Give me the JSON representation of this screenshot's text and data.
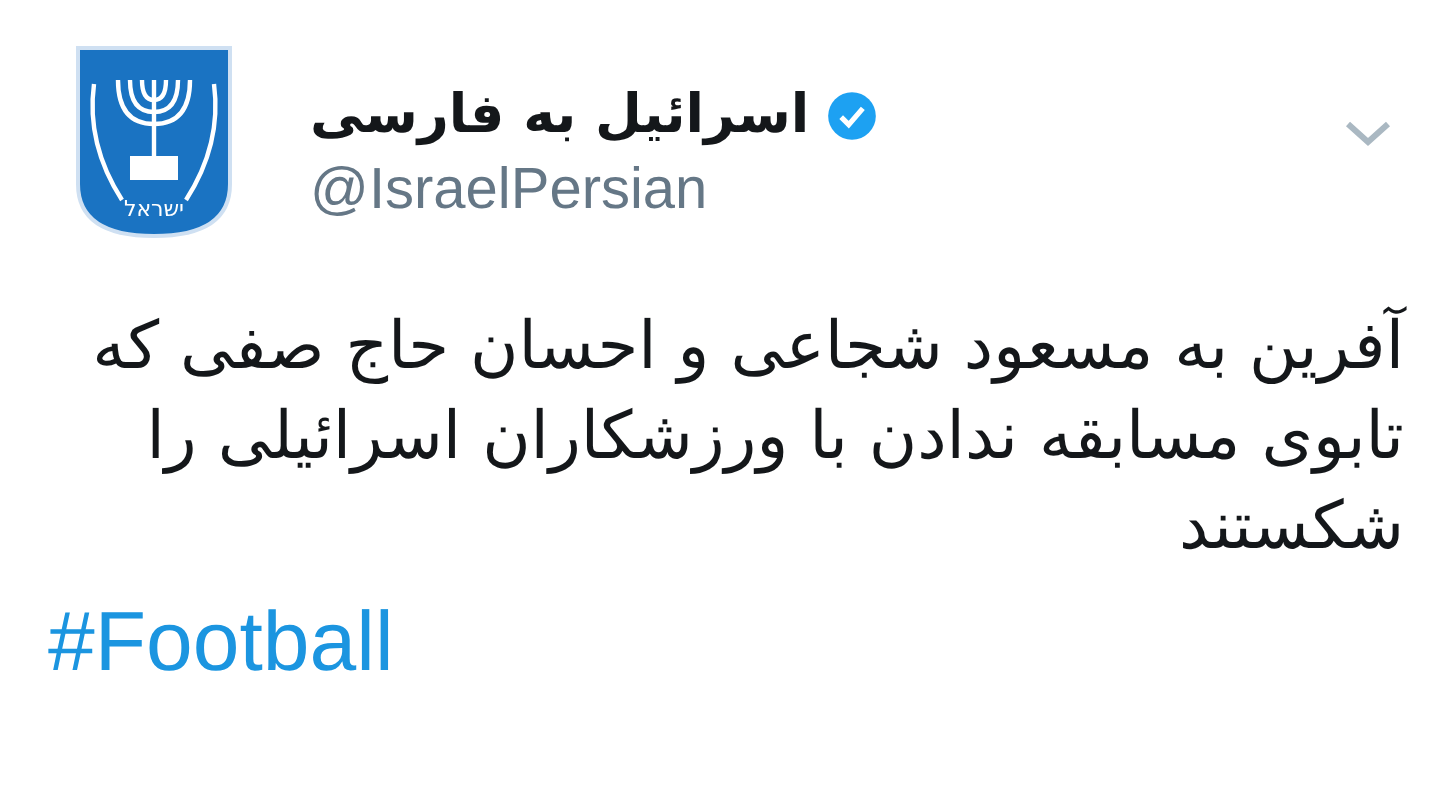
{
  "tweet": {
    "author": {
      "name": "اسرائیل به فارسی",
      "verified": true,
      "handle": "@IsraelPersian",
      "avatar_text": "ישראל"
    },
    "text": "آفرین به مسعود شجاعی و احسان حاج صفی که تابوی مسابقه ندادن با ورزشکاران اسرائیلی را شکستند",
    "hashtag": "#Football"
  }
}
